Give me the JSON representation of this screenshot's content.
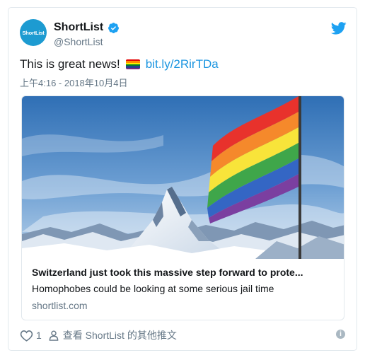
{
  "tweet": {
    "avatar_text": "ShortList",
    "display_name": "ShortList",
    "handle": "@ShortList",
    "text": "This is great news!",
    "emoji": "rainbow-flag",
    "link": "bit.ly/2RirTDa",
    "timestamp": "上午4:16 - 2018年10月4日"
  },
  "card": {
    "title": "Switzerland just took this massive step forward to prote...",
    "description": "Homophobes could be looking at some serious jail time",
    "domain": "shortlist.com"
  },
  "footer": {
    "like_count": "1",
    "view_more": "查看 ShortList 的其他推文"
  },
  "colors": {
    "twitter_blue": "#1da1f2",
    "link_blue": "#1b95e0",
    "secondary_text": "#657786",
    "border": "#e1e8ed"
  }
}
